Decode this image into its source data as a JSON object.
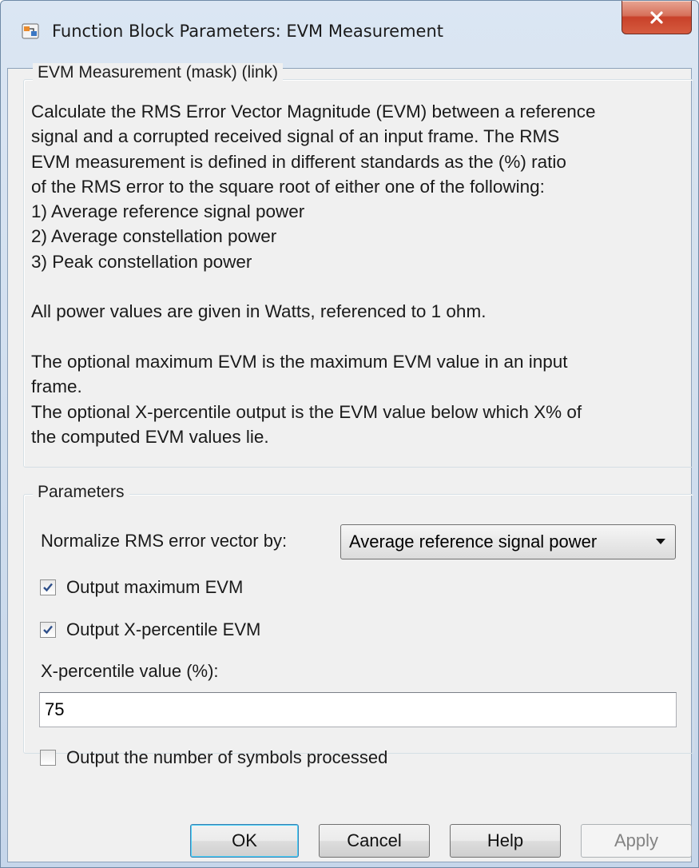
{
  "window": {
    "title": "Function Block Parameters: EVM Measurement"
  },
  "description_group": {
    "legend": "EVM Measurement (mask) (link)",
    "lines": [
      "Calculate the RMS Error Vector Magnitude (EVM) between a reference",
      "signal and a corrupted received signal of an input frame. The RMS",
      "EVM measurement is defined in different standards as the (%) ratio",
      "of the RMS error to the square root of either one of the following:",
      "1) Average reference signal power",
      "2) Average constellation power",
      "3) Peak constellation power",
      "",
      "All power values are given in Watts, referenced to 1 ohm.",
      "",
      "The optional maximum EVM is the maximum EVM value in an input",
      "frame.",
      "The optional X-percentile output is the EVM value below which X% of",
      "the computed EVM values lie."
    ]
  },
  "parameters": {
    "legend": "Parameters",
    "normalize_label": "Normalize RMS error vector by:",
    "normalize_value": "Average reference signal power",
    "output_max_evm": {
      "label": "Output maximum EVM",
      "checked": true
    },
    "output_xpercentile_evm": {
      "label": "Output X-percentile EVM",
      "checked": true
    },
    "xpercentile_label": "X-percentile value (%):",
    "xpercentile_value": "75",
    "output_num_symbols": {
      "label": "Output the number of symbols processed",
      "checked": false
    }
  },
  "buttons": {
    "ok": "OK",
    "cancel": "Cancel",
    "help": "Help",
    "apply": "Apply"
  },
  "icons": {
    "app": "simulink-block-icon",
    "close": "close-icon",
    "checkmark": "checkmark-icon",
    "dropdown": "chevron-down-icon"
  }
}
